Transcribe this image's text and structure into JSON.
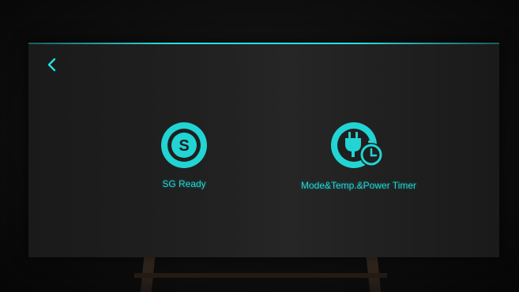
{
  "screen": {
    "accent_color": "#27e0e0",
    "background_color": "#202020",
    "back_button": {
      "icon": "chevron-left-icon"
    }
  },
  "tiles": [
    {
      "label": "SG Ready",
      "icon": "sg-ready-icon",
      "glyph": "S"
    },
    {
      "label": "Mode&Temp.&Power Timer",
      "icon": "plug-timer-icon"
    }
  ]
}
